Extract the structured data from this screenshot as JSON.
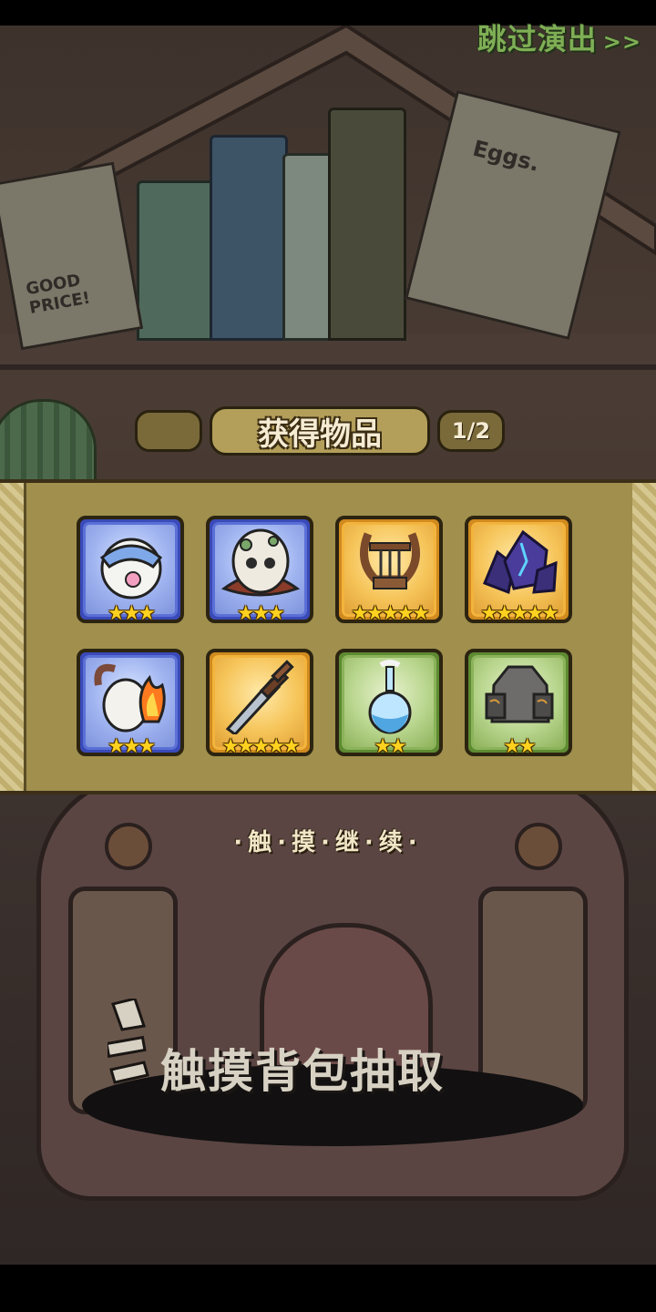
{
  "header": {
    "skip_label": "跳过演出",
    "skip_arrows": ">>"
  },
  "scene_text": {
    "poster_left": "GOOD PRICE!",
    "poster_right": "Eggs."
  },
  "reward_panel": {
    "title": "获得物品",
    "page_indicator": "1/2",
    "items": [
      {
        "name": "bandana-egg",
        "icon": "bandana-egg-icon",
        "rarity": "blue",
        "stars": 3,
        "star_text": "★★★"
      },
      {
        "name": "skull-egg",
        "icon": "skull-egg-icon",
        "rarity": "blue",
        "stars": 3,
        "star_text": "★★★"
      },
      {
        "name": "lyre",
        "icon": "lyre-icon",
        "rarity": "orange",
        "stars": 5,
        "star_text": "★★★★★"
      },
      {
        "name": "dark-crystal",
        "icon": "crystal-icon",
        "rarity": "orange",
        "stars": 5,
        "star_text": "★★★★★"
      },
      {
        "name": "fire-horn-egg",
        "icon": "fire-horn-egg-icon",
        "rarity": "blue",
        "stars": 3,
        "star_text": "★★★"
      },
      {
        "name": "sword",
        "icon": "sword-icon",
        "rarity": "orange",
        "stars": 5,
        "star_text": "★★★★★"
      },
      {
        "name": "potion-flask",
        "icon": "flask-icon",
        "rarity": "green",
        "stars": 2,
        "star_text": "★★"
      },
      {
        "name": "stone-helmet",
        "icon": "helmet-icon",
        "rarity": "green",
        "stars": 2,
        "star_text": "★★"
      }
    ]
  },
  "continue_hint": "·触·摸·继·续·",
  "draw_hint": "触摸背包抽取",
  "colors": {
    "blue_frame": "#3a4ab8",
    "orange_frame": "#d08a1e",
    "green_frame": "#5e8a32",
    "star": "#ffd21f",
    "skip_text": "#7fae55"
  }
}
